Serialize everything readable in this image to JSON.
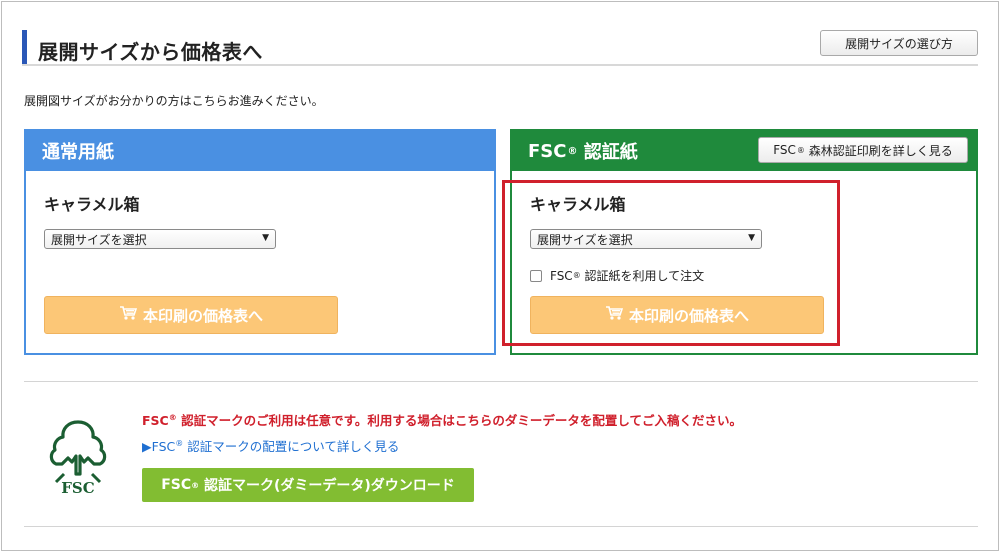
{
  "header": {
    "title": "展開サイズから価格表へ",
    "guide_button": "展開サイズの選び方"
  },
  "intro": "展開図サイズがお分かりの方はこちらお進みください。",
  "normal_panel": {
    "title": "通常用紙",
    "product": "キャラメル箱",
    "select_value": "展開サイズを選択",
    "price_button": "本印刷の価格表へ"
  },
  "fsc_panel": {
    "title_prefix": "FSC",
    "title_suffix": "認証紙",
    "detail_button_prefix": "FSC",
    "detail_button_suffix": "森林認証印刷を詳しく見る",
    "product": "キャラメル箱",
    "select_value": "展開サイズを選択",
    "checkbox_prefix": "FSC",
    "checkbox_suffix": "認証紙を利用して注文",
    "checkbox_checked": false,
    "price_button": "本印刷の価格表へ"
  },
  "registered_mark": "®",
  "fsc_mark": {
    "logo_text": "FSC",
    "notice_prefix": "FSC",
    "notice_suffix": "認証マークのご利用は任意です。利用する場合はこちらのダミーデータを配置してご入稿ください。",
    "link_prefix": "▶FSC",
    "link_suffix": "認証マークの配置について詳しく見る",
    "download_prefix": "FSC",
    "download_suffix": "認証マーク(ダミーデータ)ダウンロード"
  },
  "colors": {
    "title_bar": "#2a57b7",
    "normal_accent": "#4a90e2",
    "fsc_accent": "#1f8a3c",
    "price_button": "#fcc777",
    "highlight": "#d0202c",
    "notice": "#d0202c",
    "link": "#1f6fd1",
    "download_button": "#82bd32"
  },
  "icons": {
    "cart": "cart-icon",
    "select_arrow": "chevron-down-icon",
    "fsc_logo": "fsc-tree-logo-icon"
  }
}
